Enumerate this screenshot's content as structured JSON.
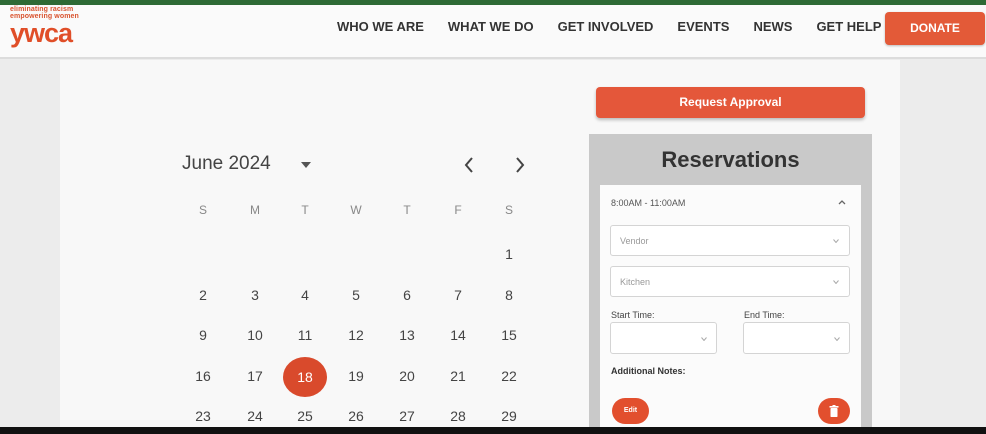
{
  "brand": {
    "tagline_line1": "eliminating racism",
    "tagline_line2": "empowering women",
    "wordmark": "ywca",
    "logo_icon": "ywca-logo-icon"
  },
  "nav": {
    "items": [
      "WHO WE ARE",
      "WHAT WE DO",
      "GET INVOLVED",
      "EVENTS",
      "NEWS",
      "GET HELP"
    ],
    "donate_label": "DONATE"
  },
  "calendar": {
    "month_label": "June 2024",
    "weekday_headers": [
      "S",
      "M",
      "T",
      "W",
      "T",
      "F",
      "S"
    ],
    "weeks": [
      [
        "",
        "",
        "",
        "",
        "",
        "",
        "1"
      ],
      [
        "2",
        "3",
        "4",
        "5",
        "6",
        "7",
        "8"
      ],
      [
        "9",
        "10",
        "11",
        "12",
        "13",
        "14",
        "15"
      ],
      [
        "16",
        "17",
        "18",
        "19",
        "20",
        "21",
        "22"
      ],
      [
        "23",
        "24",
        "25",
        "26",
        "27",
        "28",
        "29"
      ]
    ],
    "selected_day": "18",
    "icons": {
      "month_dropdown": "caret-down-icon",
      "prev": "chevron-left-icon",
      "next": "chevron-right-icon"
    }
  },
  "reservation": {
    "request_button_label": "Request Approval",
    "title": "Reservations",
    "slot_label": "8:00AM - 11:00AM",
    "vendor_placeholder": "Vendor",
    "room_placeholder": "Kitchen",
    "start_time_label": "Start Time:",
    "end_time_label": "End Time:",
    "notes_label": "Additional Notes:",
    "edit_label": "Edit",
    "delete_icon": "trash-icon"
  },
  "colors": {
    "accent": "#e35a38",
    "selected_day": "#d94a2c",
    "top_stripe": "#2e6a35"
  }
}
